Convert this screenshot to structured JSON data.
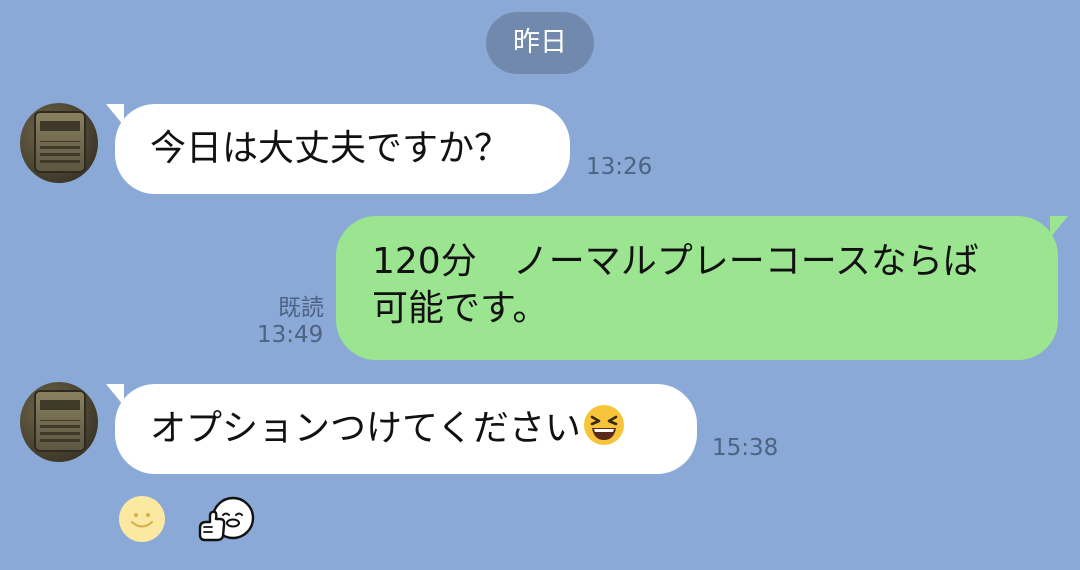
{
  "date_divider": "昨日",
  "messages": [
    {
      "direction": "incoming",
      "text": "今日は大丈夫ですか？",
      "time": "13:26"
    },
    {
      "direction": "outgoing",
      "line1": "120分　ノーマルプレーコースならば",
      "line2": "可能です。",
      "read_label": "既読",
      "time": "13:49"
    },
    {
      "direction": "incoming",
      "text": "オプションつけてください",
      "emoji": "grinning-squinting-face",
      "time": "15:38"
    }
  ],
  "reactions": [
    "smiley-face-icon",
    "thumbs-up-character-icon"
  ],
  "colors": {
    "background": "#8aa9d6",
    "incoming_bubble": "#ffffff",
    "outgoing_bubble": "#9be590",
    "date_pill": "#7189ad",
    "timestamp": "#4d6382"
  }
}
